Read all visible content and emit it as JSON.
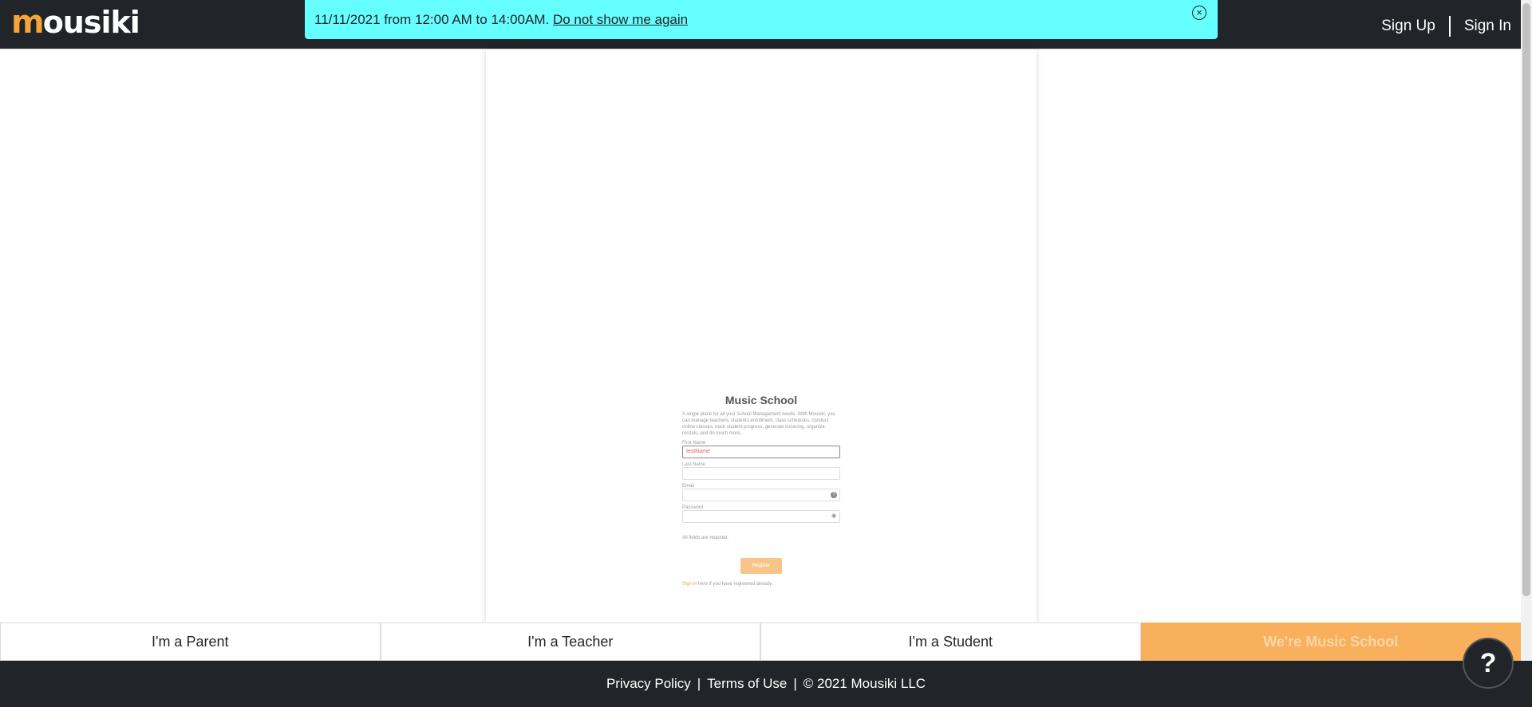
{
  "header": {
    "logo_initial": "m",
    "logo_rest": "ousiki",
    "sign_up": "Sign Up",
    "sign_in": "Sign In"
  },
  "notice": {
    "text": "11/11/2021 from 12:00 AM to 14:00AM.",
    "link": "Do not show me again",
    "close_icon": "close-circle-icon"
  },
  "preview_form": {
    "title": "Music School",
    "description": "A single place for all your School Management needs. With Mousiki, you can manage teachers, students enrollment, class schedules, conduct online classes, track student progress, generate invoicing, organize recitals, and do much more.",
    "first_name_label": "First Name",
    "first_name_value": "testName",
    "last_name_label": "Last Name",
    "email_label": "Email",
    "password_label": "Password",
    "required_note": "All fields are required.",
    "register_button": "Register",
    "signin_link": "Sign in",
    "signin_rest": "here if you have registered already.",
    "email_help_icon": "question-icon",
    "password_eye_icon": "eye-icon"
  },
  "roles": [
    {
      "label": "I'm a Parent"
    },
    {
      "label": "I'm a Teacher"
    },
    {
      "label": "I'm a Student"
    },
    {
      "label": "We're Music School"
    }
  ],
  "footer": {
    "privacy": "Privacy Policy",
    "terms": "Terms of Use",
    "copyright": "© 2021 Mousiki LLC",
    "separator": "|"
  },
  "help_button": "?",
  "colors": {
    "dark": "#212529",
    "accent": "#f8b05c",
    "notice": "#66ffff"
  }
}
